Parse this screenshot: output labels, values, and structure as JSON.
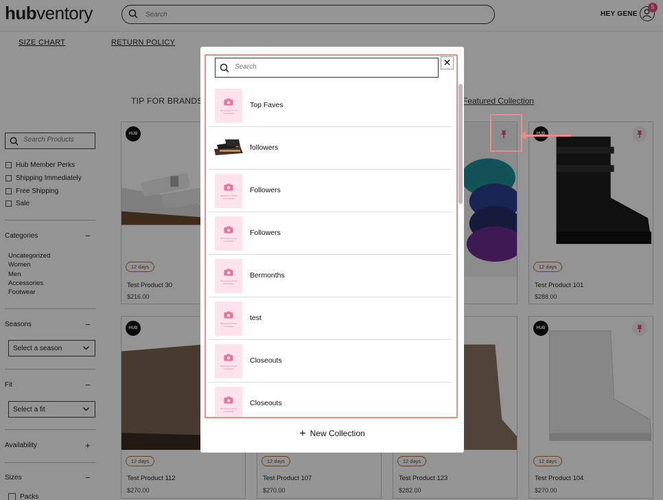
{
  "header": {
    "logo_bold": "hub",
    "logo_light": "ventory",
    "search_placeholder": "Search",
    "greeting": "HEY GENE",
    "notification_count": "5"
  },
  "subnav": {
    "size_chart": "SIZE CHART",
    "return_policy": "RETURN POLICY"
  },
  "tip": {
    "prefix": "TIP FOR BRANDS: ",
    "link": "Featured Collection",
    "suffix": "."
  },
  "sidebar": {
    "search_placeholder": "Search Products",
    "filters": [
      "Hub Member Perks",
      "Shipping Immediately",
      "Free Shipping",
      "Sale"
    ],
    "categories_title": "Categories",
    "categories": [
      "Uncategorized",
      "Women",
      "Men",
      "Accessories",
      "Footwear"
    ],
    "seasons_title": "Seasons",
    "season_select": "Select a season",
    "fit_title": "Fit",
    "fit_select": "Select a fit",
    "availability_title": "Availability",
    "sizes_title": "Sizes",
    "sizes": [
      "Packs"
    ]
  },
  "products": [
    {
      "name": "Test Product 30",
      "price": "$216.00",
      "days": "12 days"
    },
    {
      "name": "Test Product 101",
      "price": "$288.00",
      "days": "12 days"
    },
    {
      "name": "Test Product 112",
      "price": "$270.00",
      "days": "12 days"
    },
    {
      "name": "Test Product 107",
      "price": "$270.00",
      "days": "12 days"
    },
    {
      "name": "Test Product 123",
      "price": "$282.00",
      "days": "12 days"
    },
    {
      "name": "Test Product 104",
      "price": "$270.00",
      "days": "12 days"
    }
  ],
  "badges": {
    "hub": "HUB"
  },
  "modal": {
    "search_placeholder": "Search",
    "close_symbol": "✕",
    "placeholder_caption": "Placeholder Photo Unavailable",
    "collections": [
      "Top Faves",
      "followers",
      "Followers",
      "Followers",
      "Bermonths",
      "test",
      "Closeouts",
      "Closeouts"
    ],
    "new_collection": "New Collection"
  },
  "colors": {
    "accent_pink": "#e8478a",
    "highlight": "#f08a8a",
    "thumb_bg": "#fde3ec"
  }
}
